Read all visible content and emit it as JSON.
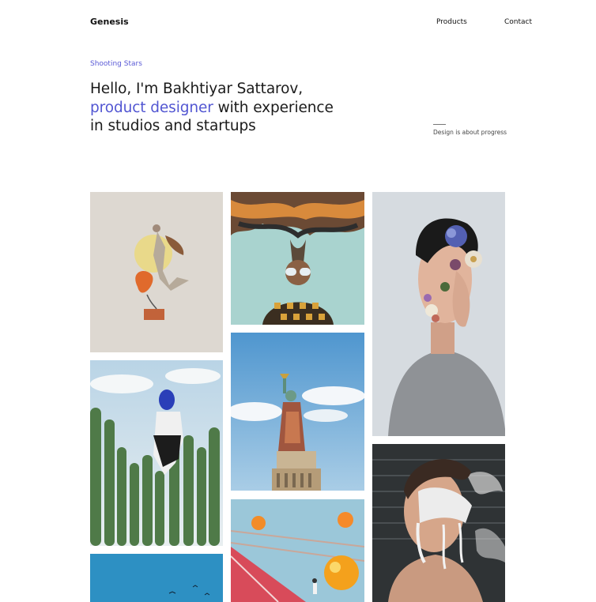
{
  "header": {
    "logo": "Genesis",
    "nav": {
      "products": "Products",
      "contact": "Contact"
    }
  },
  "hero": {
    "eyebrow": "Shooting Stars",
    "headline_line1": "Hello, I'm Bakhtiyar Sattarov,",
    "headline_accent": "product designer",
    "headline_rest1": " with experience",
    "headline_line3": "in studios and startups",
    "tagline": "Design is about progress"
  },
  "colors": {
    "accent": "#5256d2",
    "text": "#1b1b1b",
    "background": "#ffffff"
  },
  "gallery": {
    "items": [
      {
        "name": "dancer-collage"
      },
      {
        "name": "cactus-balloon"
      },
      {
        "name": "sky-birds"
      },
      {
        "name": "smoke-glasses-portrait"
      },
      {
        "name": "statue-of-liberty"
      },
      {
        "name": "orange-spheres-runway"
      },
      {
        "name": "flower-face-portrait"
      },
      {
        "name": "graffiti-portrait"
      }
    ]
  }
}
